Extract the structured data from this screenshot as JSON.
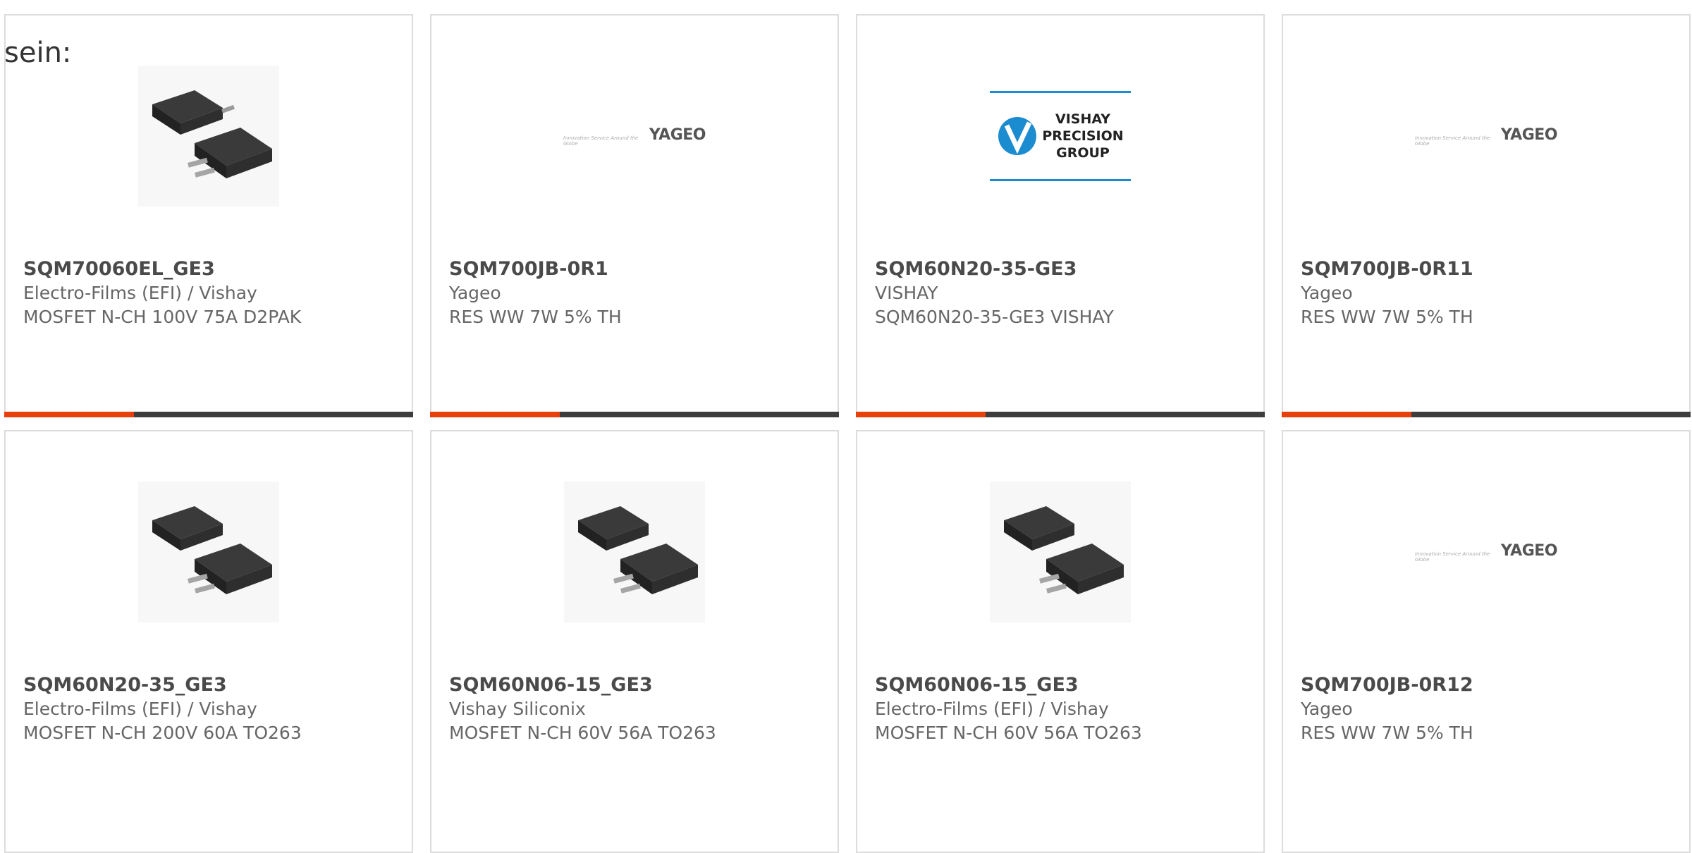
{
  "intro_text": "sein:",
  "products": [
    {
      "part": "SQM70060EL_GE3",
      "manufacturer": "Electro-Films (EFI) / Vishay",
      "description": "MOSFET N-CH 100V 75A D2PAK",
      "image": "mosfet-package-icon"
    },
    {
      "part": "SQM700JB-0R1",
      "manufacturer": "Yageo",
      "description": "RES WW 7W 5% TH",
      "image": "yageo-logo"
    },
    {
      "part": "SQM60N20-35-GE3",
      "manufacturer": "VISHAY",
      "description": "SQM60N20-35-GE3 VISHAY",
      "image": "vishay-precision-group-logo"
    },
    {
      "part": "SQM700JB-0R11",
      "manufacturer": "Yageo",
      "description": "RES WW 7W 5% TH",
      "image": "yageo-logo"
    },
    {
      "part": "SQM60N20-35_GE3",
      "manufacturer": "Electro-Films (EFI) / Vishay",
      "description": "MOSFET N-CH 200V 60A TO263",
      "image": "mosfet-package-icon"
    },
    {
      "part": "SQM60N06-15_GE3",
      "manufacturer": "Vishay Siliconix",
      "description": "MOSFET N-CH 60V 56A TO263",
      "image": "mosfet-package-icon"
    },
    {
      "part": "SQM60N06-15_GE3",
      "manufacturer": "Electro-Films (EFI) / Vishay",
      "description": "MOSFET N-CH 60V 56A TO263",
      "image": "mosfet-package-icon"
    },
    {
      "part": "SQM700JB-0R12",
      "manufacturer": "Yageo",
      "description": "RES WW 7W 5% TH",
      "image": "yageo-logo"
    }
  ],
  "logos": {
    "yageo_word": "YAGEO",
    "yageo_tagline": "Innovation Service Around the Globe",
    "vpg_lines": [
      "VISHAY",
      "PRECISION",
      "GROUP"
    ],
    "vpg_symbol": "V"
  },
  "colors": {
    "accent": "#e8400c",
    "bar": "#3d3d3d",
    "vpg_blue": "#1b8ccf"
  }
}
